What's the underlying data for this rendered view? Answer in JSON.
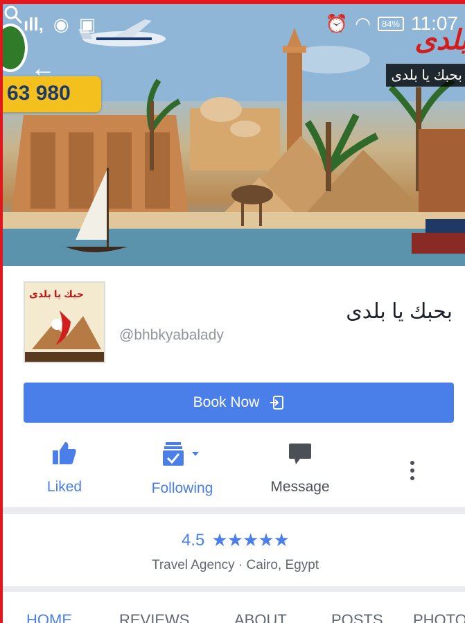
{
  "status_bar": {
    "left_text": "ıll,",
    "battery": "84%",
    "time": "11:07"
  },
  "cover": {
    "likes_count": "63 980",
    "brand_text": "بلدى",
    "caption": "بحبك يا بلدى"
  },
  "page": {
    "name": "بحبك يا بلدى",
    "handle": "@bhbkyabalady",
    "profile_caption": "حبك يا بلدى",
    "book_label": "Book Now"
  },
  "actions": {
    "liked": "Liked",
    "following": "Following",
    "message": "Message"
  },
  "rating": {
    "score": "4.5",
    "stars": "★★★★★",
    "category": "Travel Agency · Cairo, Egypt"
  },
  "tabs": [
    "HOME",
    "REVIEWS",
    "ABOUT",
    "POSTS",
    "PHOTOS"
  ],
  "colors": {
    "accent": "#4a7ee8",
    "badge": "#f3c01d",
    "frame": "#e2161d"
  }
}
